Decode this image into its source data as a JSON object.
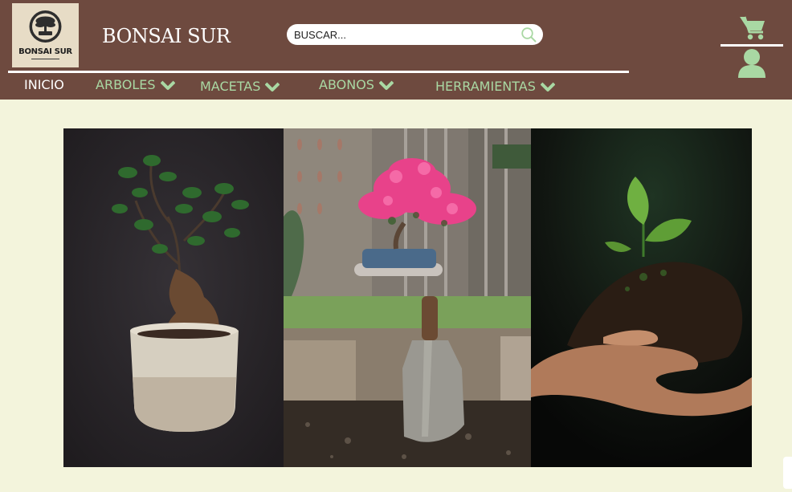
{
  "header": {
    "logo": {
      "text": "BONSAI SUR"
    },
    "brand": "BONSAI SUR",
    "search": {
      "placeholder": "BUSCAR..."
    }
  },
  "nav": [
    {
      "label": "INICIO",
      "active": true
    },
    {
      "label": "ARBOLES"
    },
    {
      "label": "MACETAS"
    },
    {
      "label": "ABONOS"
    },
    {
      "label": "HERRAMIENTAS"
    }
  ],
  "colors": {
    "header_bg": "#6e4a3f",
    "page_bg": "#f3f4dc",
    "nav_text": "#a9d8a3",
    "icon_green": "#a9d8a3"
  },
  "icons": [
    "search-icon",
    "cart-icon",
    "user-icon",
    "chevron-down-icon"
  ],
  "banner": {
    "panels": [
      "ficus-bonsai-photo",
      "azalea-bonsai-photo",
      "trowel-soil-photo",
      "seedling-hands-photo"
    ]
  }
}
